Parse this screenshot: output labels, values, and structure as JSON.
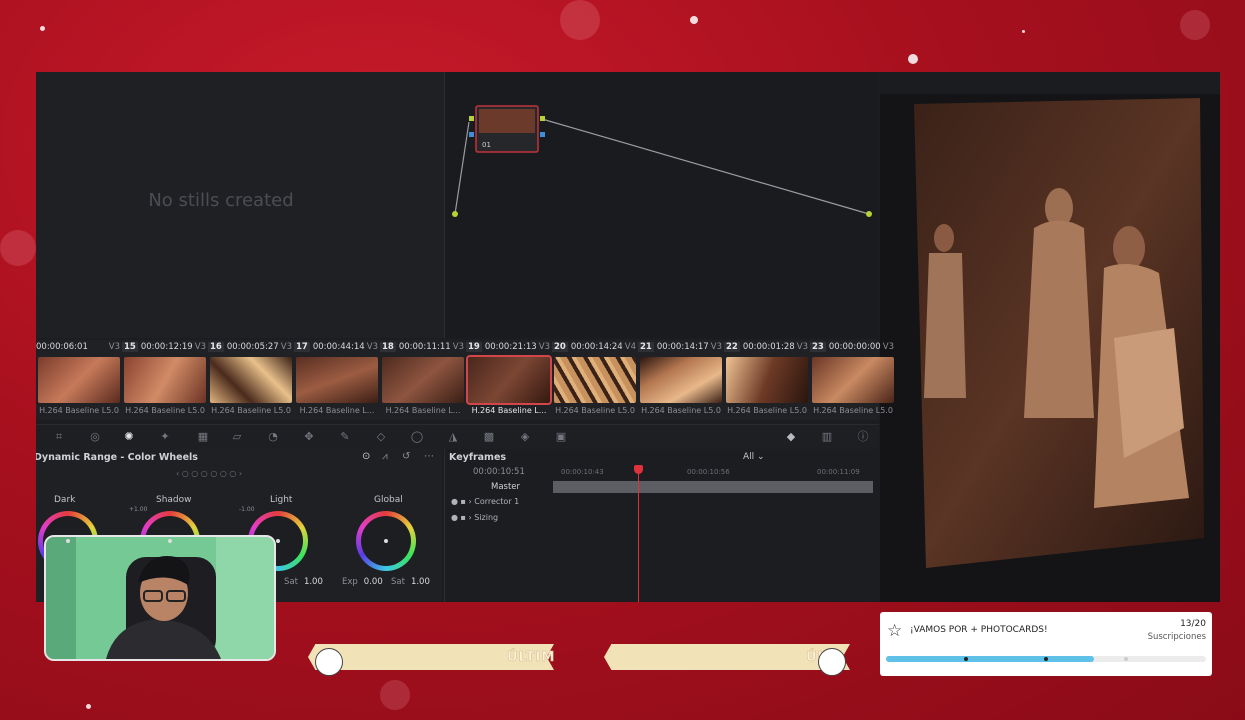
{
  "gallery": {
    "empty_text": "No stills created"
  },
  "node_editor": {
    "node_label": "01"
  },
  "clips": [
    {
      "num": "",
      "timecode": "00:00:06:01",
      "track": "V3",
      "codec": "H.264 Baseline L5.0",
      "selected": false
    },
    {
      "num": "15",
      "timecode": "00:00:12:19",
      "track": "V3",
      "codec": "H.264 Baseline L5.0",
      "selected": false
    },
    {
      "num": "16",
      "timecode": "00:00:05:27",
      "track": "V3",
      "codec": "H.264 Baseline L5.0",
      "selected": false
    },
    {
      "num": "17",
      "timecode": "00:00:44:14",
      "track": "V3",
      "codec": "H.264 Baseline L...",
      "selected": false
    },
    {
      "num": "18",
      "timecode": "00:00:11:11",
      "track": "V3",
      "codec": "H.264 Baseline L...",
      "selected": false
    },
    {
      "num": "19",
      "timecode": "00:00:21:13",
      "track": "V3",
      "codec": "H.264 Baseline L...",
      "selected": true
    },
    {
      "num": "20",
      "timecode": "00:00:14:24",
      "track": "V4",
      "codec": "H.264 Baseline L5.0",
      "selected": false
    },
    {
      "num": "21",
      "timecode": "00:00:14:17",
      "track": "V3",
      "codec": "H.264 Baseline L5.0",
      "selected": false
    },
    {
      "num": "22",
      "timecode": "00:00:01:28",
      "track": "V3",
      "codec": "H.264 Baseline L5.0",
      "selected": false
    },
    {
      "num": "23",
      "timecode": "00:00:00:00",
      "track": "V3",
      "codec": "H.264 Baseline L5.0",
      "selected": false
    }
  ],
  "wheels": {
    "title": "Dynamic Range - Color Wheels",
    "items": [
      {
        "label": "Dark"
      },
      {
        "label": "Shadow",
        "sub": "+1.00"
      },
      {
        "label": "Light",
        "sub": "-1.00"
      },
      {
        "label": "Global"
      }
    ],
    "params": [
      {
        "label": "Sat",
        "value": "1.00"
      },
      {
        "label": "Exp",
        "value": "0.00"
      },
      {
        "label": "Sat",
        "value": "1.00"
      }
    ]
  },
  "keyframes": {
    "title": "Keyframes",
    "filter": "All",
    "timecode": "00:00:10:51",
    "ticks": [
      "00:00:10:43",
      "00:00:10:56",
      "00:00:11:09"
    ],
    "master": "Master",
    "rows": [
      "Corrector 1",
      "Sizing"
    ]
  },
  "banners": {
    "left_text": "ÚLTIM",
    "right_text": "ÚL"
  },
  "goal": {
    "title": "¡VAMOS POR + PHOTOCARDS!",
    "count": "13/20",
    "count_label": "Suscripciones",
    "progress": 0.65,
    "accent": "#5fc0e8"
  },
  "colors": {
    "background": "#a8101e",
    "selection": "#d0464b",
    "playhead": "#e0323a"
  }
}
